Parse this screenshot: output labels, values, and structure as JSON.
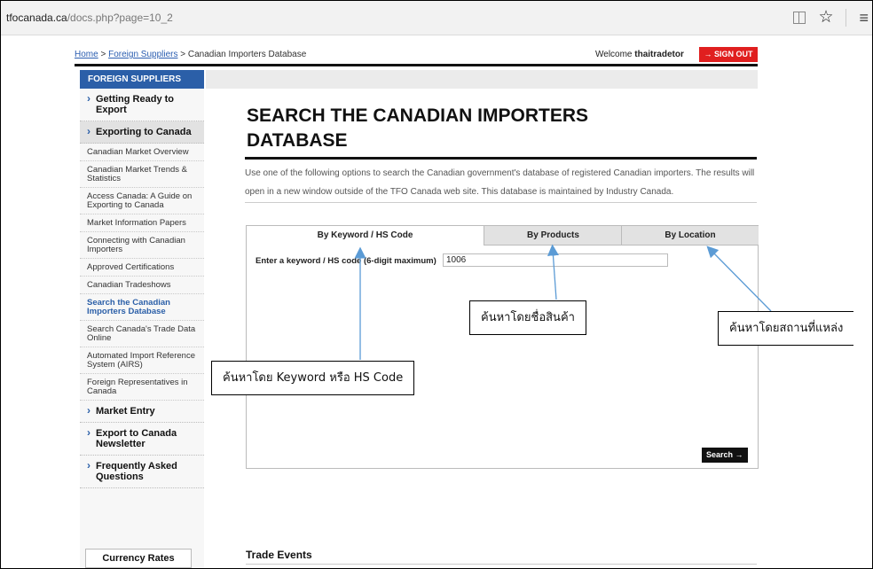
{
  "browser": {
    "url_domain": "tfocanada.ca",
    "url_path": "/docs.php?page=10_2",
    "icons": [
      "reader-view-icon",
      "star-icon",
      "hub-menu-icon"
    ]
  },
  "breadcrumb": {
    "home": "Home",
    "sep": " > ",
    "foreign_suppliers": "Foreign Suppliers",
    "current": "Canadian Importers Database"
  },
  "account": {
    "welcome_label": "Welcome",
    "username": "thaitradetor",
    "sign_out": "→ SIGN OUT"
  },
  "sidebar": {
    "header": "FOREIGN SUPPLIERS",
    "getting_ready": "Getting Ready to Export",
    "exporting": "Exporting to Canada",
    "sub_items": [
      "Canadian Market Overview",
      "Canadian Market Trends & Statistics",
      "Access Canada: A Guide on Exporting to Canada",
      "Market Information Papers",
      "Connecting with Canadian Importers",
      "Approved Certifications",
      "Canadian Tradeshows",
      "Search the Canadian Importers Database",
      "Search Canada's Trade Data Online",
      "Automated Import Reference System (AIRS)",
      "Foreign Representatives in Canada"
    ],
    "market_entry": "Market Entry",
    "newsletter": "Export to Canada Newsletter",
    "faq": "Frequently Asked Questions",
    "currency": "Currency Rates"
  },
  "main": {
    "title": "SEARCH THE CANADIAN IMPORTERS DATABASE",
    "description": "Use one of the following options to search the Canadian government's database of registered Canadian importers. The results will open in a new window outside of the TFO Canada web site. This database is maintained by Industry Canada.",
    "tabs": [
      "By Keyword / HS Code",
      "By Products",
      "By Location"
    ],
    "active_tab": 0,
    "keyword_label": "Enter a keyword / HS code (6-digit maximum)",
    "keyword_value": "1006",
    "search_button": "Search →",
    "trade_events": "Trade Events"
  },
  "annotations": {
    "keyword_callout": "ค้นหาโดย Keyword หรือ HS Code",
    "products_callout": "ค้นหาโดยชื่อสินค้า",
    "location_callout": "ค้นหาโดยสถานที่แหล่ง"
  },
  "colors": {
    "accent_blue": "#2b5fa8",
    "signout_red": "#e01f1f",
    "arrow_blue": "#5b9bd5"
  }
}
